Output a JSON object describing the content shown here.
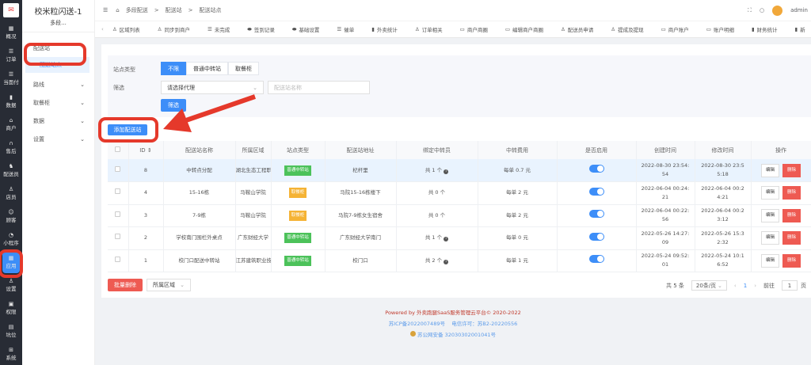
{
  "nav": [
    {
      "icon": "dashboard-icon",
      "label": "概况"
    },
    {
      "icon": "list-icon",
      "label": "订单"
    },
    {
      "icon": "list-icon",
      "label": "当面付"
    },
    {
      "icon": "bar-chart-icon",
      "label": "数据"
    },
    {
      "icon": "store-icon",
      "label": "商户"
    },
    {
      "icon": "headset-icon",
      "label": "售后"
    },
    {
      "icon": "rider-icon",
      "label": "配送员"
    },
    {
      "icon": "user-icon",
      "label": "店员"
    },
    {
      "icon": "customer-icon",
      "label": "顾客"
    },
    {
      "icon": "wechat-icon",
      "label": "小程序"
    },
    {
      "icon": "apps-icon",
      "label": "应用"
    },
    {
      "icon": "user-settings-icon",
      "label": "设置"
    },
    {
      "icon": "lock-icon",
      "label": "权限"
    },
    {
      "icon": "pit-icon",
      "label": "坑位"
    },
    {
      "icon": "windows-icon",
      "label": "系统"
    }
  ],
  "sub": {
    "title": "校米粒闪送-1",
    "subtitle": "多段...",
    "groups": [
      {
        "label": "配送站",
        "children": [
          "配送站点"
        ]
      },
      {
        "label": "路线"
      },
      {
        "label": "取餐柜"
      },
      {
        "label": "数据"
      },
      {
        "label": "设置"
      }
    ]
  },
  "header": {
    "breadcrumb": [
      "多段配送",
      "配送站",
      "配送站点"
    ],
    "user": "admin"
  },
  "tabs": [
    "区域列表",
    "同步到商户",
    "未完成",
    "签到记录",
    "基础设置",
    "催单",
    "外卖统计",
    "订单相关",
    "商户商圈",
    "编辑商户商圈",
    "配送员申请",
    "提成及提现",
    "商户账户",
    "账户明细",
    "财务统计",
    "新"
  ],
  "filter": {
    "type_label": "站点类型",
    "types": [
      "不限",
      "普通中转站",
      "取餐柜"
    ],
    "filter_label": "筛选",
    "agent_placeholder": "请选择代理",
    "name_placeholder": "配送站名称",
    "filter_button": "筛选"
  },
  "add_button": "添加配送站",
  "table": {
    "headers": [
      "ID",
      "配送站名称",
      "所属区域",
      "站点类型",
      "配送站地址",
      "绑定中转员",
      "中转费用",
      "是否启用",
      "创建时间",
      "修改时间",
      "操作"
    ],
    "rows": [
      {
        "id": "8",
        "name": "中转点分配",
        "region": "湖北生态工程职",
        "type": "普通中转站",
        "type_color": "#4cc25a",
        "address": "杞杆里",
        "riders": "共 1 个",
        "info": true,
        "fee": "每单 0.7 元",
        "created": "2022-08-30 23:54:54",
        "modified": "2022-08-30 23:55:18"
      },
      {
        "id": "4",
        "name": "15-16栋",
        "region": "马鞍山学院",
        "type": "取餐柜",
        "type_color": "#f5b335",
        "address": "马院15-16栋楼下",
        "riders": "共 0 个",
        "info": false,
        "fee": "每单 2 元",
        "created": "2022-06-04 00:24:21",
        "modified": "2022-06-04 00:24:21"
      },
      {
        "id": "3",
        "name": "7-9栋",
        "region": "马鞍山学院",
        "type": "取餐柜",
        "type_color": "#f5b335",
        "address": "马院7-9栋女生宿舍",
        "riders": "共 0 个",
        "info": false,
        "fee": "每单 2 元",
        "created": "2022-06-04 00:22:56",
        "modified": "2022-06-04 00:23:12"
      },
      {
        "id": "2",
        "name": "学校南门围栏外桌点",
        "region": "广东财经大学",
        "type": "普通中转站",
        "type_color": "#4cc25a",
        "address": "广东财经大学南门",
        "riders": "共 1 个",
        "info": true,
        "fee": "每单 0 元",
        "created": "2022-05-26 14:27:09",
        "modified": "2022-05-26 15:32:32"
      },
      {
        "id": "1",
        "name": "校门口配送中转站",
        "region": "江苏建筑职业技",
        "type": "普通中转站",
        "type_color": "#4cc25a",
        "address": "校门口",
        "riders": "共 2 个",
        "info": true,
        "fee": "每单 1 元",
        "created": "2022-05-24 09:52:01",
        "modified": "2022-05-24 10:16:52"
      }
    ],
    "edit": "编辑",
    "delete": "删除"
  },
  "bottom": {
    "batch_delete": "批量删除",
    "region_select": "所属区域"
  },
  "pagination": {
    "total": "共 5 条",
    "page_size": "20条/页",
    "current": "1",
    "goto": "前往",
    "goto_value": "1",
    "page_unit": "页"
  },
  "footer": {
    "powered": "Powered by 外卖跑腿SaaS服务管理云平台© 2020-2022",
    "icp": "苏ICP备2022007489号",
    "license": "电信许可：苏B2-20220556",
    "police": "苏公网安备 32030302001041号"
  },
  "colors": {
    "primary": "#3d8ef8",
    "danger": "#ee5a52",
    "annotation": "#e5392b"
  }
}
